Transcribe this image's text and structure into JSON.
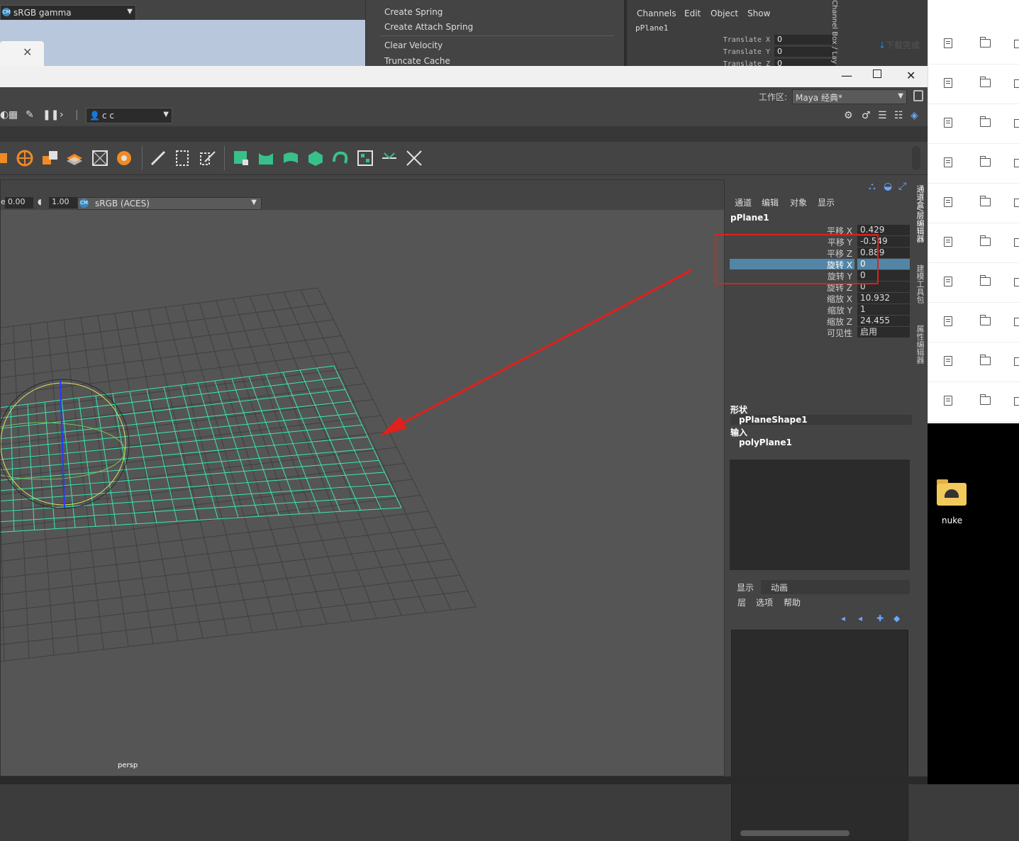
{
  "bg_left": {
    "colorspace": "sRGB gamma"
  },
  "bg_menu": {
    "items": [
      "Create Spring",
      "Create Attach Spring",
      "Clear Velocity",
      "Truncate Cache"
    ]
  },
  "bg_channelbox": {
    "menus": [
      "Channels",
      "Edit",
      "Object",
      "Show"
    ],
    "node": "pPlane1",
    "attrs": [
      {
        "name": "Translate X",
        "value": "0"
      },
      {
        "name": "Translate Y",
        "value": "0"
      },
      {
        "name": "Translate Z",
        "value": "0"
      }
    ],
    "side_tab": "Channel Box / Lay"
  },
  "explorer": {
    "download_label": "下载完成",
    "rows": 10
  },
  "desktop": {
    "folder_label": "nuke"
  },
  "workspace": {
    "label": "工作区:",
    "value": "Maya 经典*"
  },
  "user": {
    "name": "c c"
  },
  "viewport": {
    "exposure": "0.00",
    "gamma": "1.00",
    "colorspace": "sRGB (ACES)",
    "camera": "persp"
  },
  "channel_box": {
    "menus": [
      "通道",
      "编辑",
      "对象",
      "显示"
    ],
    "node": "pPlane1",
    "attrs": [
      {
        "name": "平移 X",
        "value": "0.429"
      },
      {
        "name": "平移 Y",
        "value": "-0.549"
      },
      {
        "name": "平移 Z",
        "value": "0.889"
      },
      {
        "name": "旋转 X",
        "value": "0",
        "selected": true
      },
      {
        "name": "旋转 Y",
        "value": "0"
      },
      {
        "name": "旋转 Z",
        "value": "0"
      },
      {
        "name": "缩放 X",
        "value": "10.932"
      },
      {
        "name": "缩放 Y",
        "value": "1"
      },
      {
        "name": "缩放 Z",
        "value": "24.455"
      },
      {
        "name": "可见性",
        "value": "启用"
      }
    ],
    "shape_header": "形状",
    "shape_node": "pPlaneShape1",
    "input_header": "输入",
    "input_node": "polyPlane1",
    "layer_tabs": [
      "显示",
      "动画"
    ],
    "layer_menus": [
      "层",
      "选项",
      "帮助"
    ]
  },
  "side_tabs": [
    "通道盒/层编辑器",
    "建模工具包",
    "属性编辑器"
  ],
  "colors": {
    "selection": "#5285a6",
    "annotation": "#e0201b",
    "mesh": "#38e8b0"
  }
}
